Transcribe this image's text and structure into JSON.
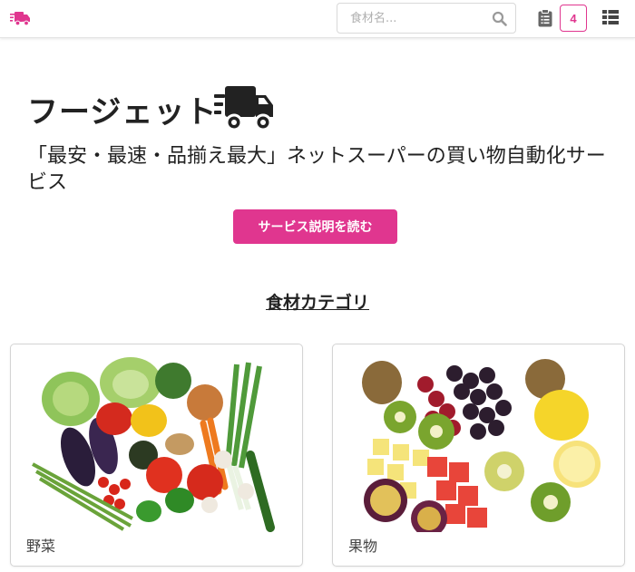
{
  "navbar": {
    "logo_icon": "delivery-truck-icon",
    "search": {
      "placeholder": "食材名...",
      "value": ""
    },
    "clipboard_icon": "clipboard-list-icon",
    "cart_count": "4",
    "list_icon": "th-list-icon",
    "accent_color": "#e0368f"
  },
  "hero": {
    "title": "フージェット",
    "title_icon": "delivery-truck-icon",
    "subtitle": "「最安・最速・品揃え最大」ネットスーパーの買い物自動化サービス",
    "cta_label": "サービス説明を読む"
  },
  "categories": {
    "heading": "食材カテゴリ",
    "items": [
      {
        "label": "野菜",
        "image": "vegetables-photo"
      },
      {
        "label": "果物",
        "image": "fruits-photo"
      }
    ]
  }
}
